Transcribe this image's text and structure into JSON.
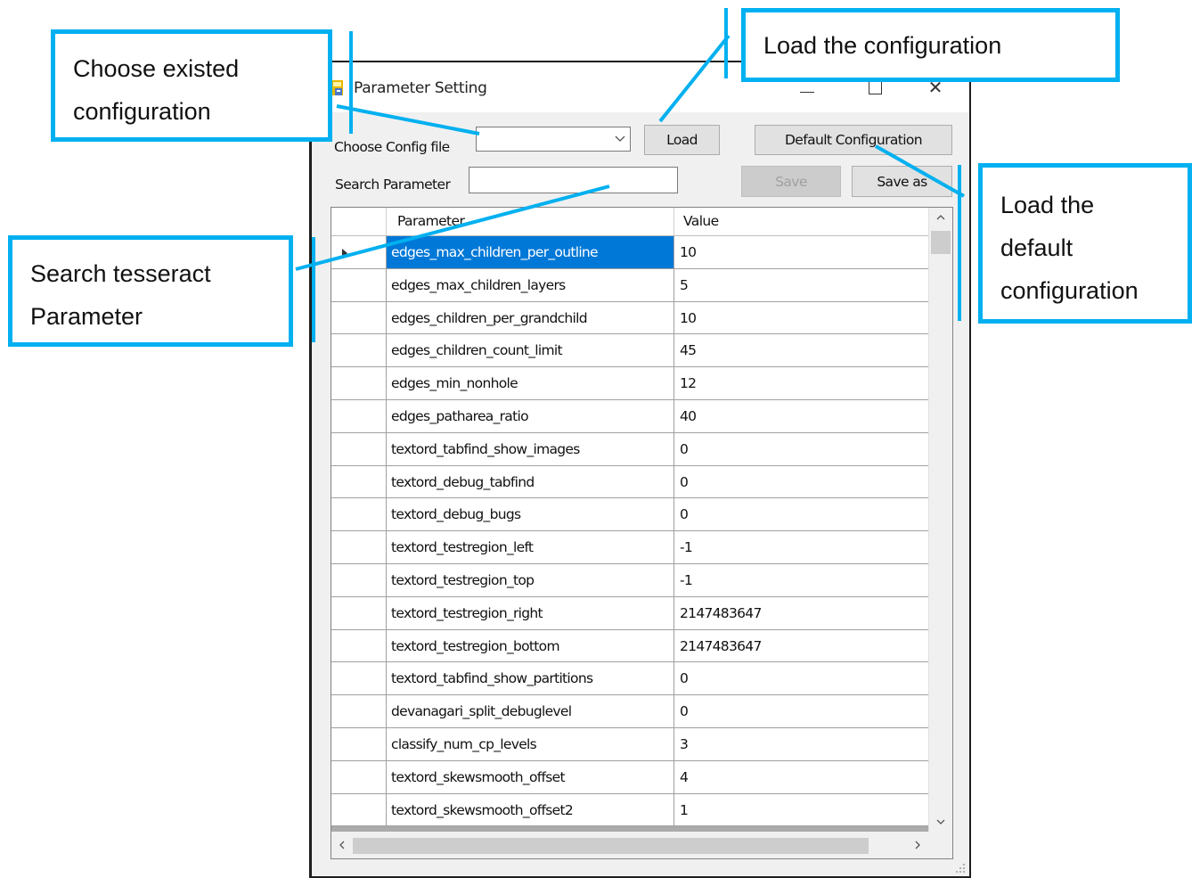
{
  "window": {
    "title": "Parameter Setting",
    "controls": {
      "minimize": "minimize",
      "maximize": "maximize",
      "close": "✕"
    }
  },
  "toolbar": {
    "config_label": "Choose Config file",
    "config_value": "",
    "search_label": "Search Parameter",
    "search_value": "",
    "load_label": "Load",
    "default_label": "Default Configuration",
    "save_label": "Save",
    "save_enabled": false,
    "saveas_label": "Save as"
  },
  "grid": {
    "columns": [
      "Parameter",
      "Value"
    ],
    "selected_row": 0,
    "rows": [
      {
        "parameter": "edges_max_children_per_outline",
        "value": "10"
      },
      {
        "parameter": "edges_max_children_layers",
        "value": "5"
      },
      {
        "parameter": "edges_children_per_grandchild",
        "value": "10"
      },
      {
        "parameter": "edges_children_count_limit",
        "value": "45"
      },
      {
        "parameter": "edges_min_nonhole",
        "value": "12"
      },
      {
        "parameter": "edges_patharea_ratio",
        "value": "40"
      },
      {
        "parameter": "textord_tabfind_show_images",
        "value": "0"
      },
      {
        "parameter": "textord_debug_tabfind",
        "value": "0"
      },
      {
        "parameter": "textord_debug_bugs",
        "value": "0"
      },
      {
        "parameter": "textord_testregion_left",
        "value": "-1"
      },
      {
        "parameter": "textord_testregion_top",
        "value": "-1"
      },
      {
        "parameter": "textord_testregion_right",
        "value": "2147483647"
      },
      {
        "parameter": "textord_testregion_bottom",
        "value": "2147483647"
      },
      {
        "parameter": "textord_tabfind_show_partitions",
        "value": "0"
      },
      {
        "parameter": "devanagari_split_debuglevel",
        "value": "0"
      },
      {
        "parameter": "classify_num_cp_levels",
        "value": "3"
      },
      {
        "parameter": "textord_skewsmooth_offset",
        "value": "4"
      },
      {
        "parameter": "textord_skewsmooth_offset2",
        "value": "1"
      }
    ]
  },
  "callouts": {
    "choose": [
      "Choose existed",
      "configuration"
    ],
    "load": [
      "Load the configuration"
    ],
    "search": [
      "Search tesseract",
      "Parameter"
    ],
    "default": [
      "Load the",
      "default",
      "configuration"
    ]
  },
  "colors": {
    "accent": "#00b0f0",
    "selection": "#0078d7"
  },
  "icons": {
    "app": "app-icon",
    "dropdown": "chevron-down-icon",
    "scroll_up": "chevron-up-icon",
    "scroll_down": "chevron-down-icon",
    "scroll_left": "chevron-left-icon",
    "scroll_right": "chevron-right-icon",
    "row_indicator": "triangle-right-icon"
  }
}
